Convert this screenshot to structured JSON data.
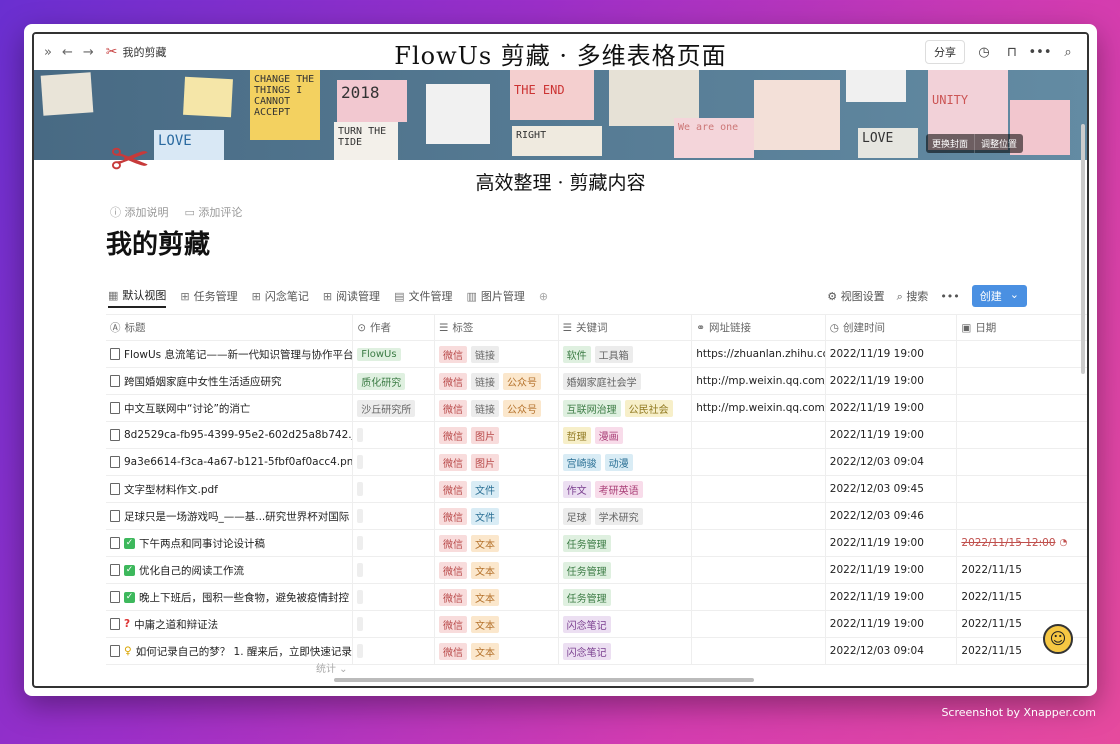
{
  "window": {
    "overlay_title": "FlowUs 剪藏 · 多维表格页面",
    "overlay_subtitle": "高效整理 · 剪藏内容",
    "breadcrumb": "我的剪藏",
    "share_label": "分享"
  },
  "cover": {
    "notes": [
      "CHANGE THE THINGS I CANNOT ACCEPT",
      "2018",
      "TURN THE TIDE",
      "THE END",
      "RIGHT",
      "LOVE",
      "UNITY",
      "We are one"
    ],
    "change_cover": "更换封面",
    "adjust_position": "调整位置"
  },
  "page": {
    "add_description": "添加说明",
    "add_comment": "添加评论",
    "title": "我的剪藏"
  },
  "views": {
    "tabs": [
      "默认视图",
      "任务管理",
      "闪念笔记",
      "阅读管理",
      "文件管理",
      "图片管理"
    ],
    "settings_label": "视图设置",
    "search_label": "搜索",
    "create_label": "创建"
  },
  "table": {
    "columns": [
      "标题",
      "作者",
      "标签",
      "关键词",
      "网址链接",
      "创建时间",
      "日期"
    ],
    "rows": [
      {
        "title": "FlowUs 息流笔记——新一代知识管理与协作平台",
        "author": "FlowUs",
        "tags": [
          "微信",
          "链接"
        ],
        "keywords": [
          "软件",
          "工具箱"
        ],
        "url": "https://zhuanlan.zhihu.com",
        "created": "2022/11/19 19:00",
        "date": ""
      },
      {
        "title": "跨国婚姻家庭中女性生活适应研究",
        "author": "质化研究",
        "tags": [
          "微信",
          "链接",
          "公众号"
        ],
        "keywords": [
          "婚姻家庭社会学"
        ],
        "url": "http://mp.weixin.qq.com/s?",
        "created": "2022/11/19 19:00",
        "date": ""
      },
      {
        "title": "中文互联网中“讨论”的消亡",
        "author": "沙丘研究所",
        "tags": [
          "微信",
          "链接",
          "公众号"
        ],
        "keywords": [
          "互联网治理",
          "公民社会"
        ],
        "url": "http://mp.weixin.qq.com/s?",
        "created": "2022/11/19 19:00",
        "date": ""
      },
      {
        "title": "8d2529ca-fb95-4399-95e2-602d25a8b742.jp",
        "author": "",
        "tags": [
          "微信",
          "图片"
        ],
        "keywords": [
          "哲理",
          "漫画"
        ],
        "url": "",
        "created": "2022/11/19 19:00",
        "date": ""
      },
      {
        "title": "9a3e6614-f3ca-4a67-b121-5fbf0af0acc4.png",
        "author": "",
        "tags": [
          "微信",
          "图片"
        ],
        "keywords": [
          "宫崎骏",
          "动漫"
        ],
        "url": "",
        "created": "2022/12/03 09:04",
        "date": ""
      },
      {
        "title": "文字型材料作文.pdf",
        "author": "",
        "tags": [
          "微信",
          "文件"
        ],
        "keywords": [
          "作文",
          "考研英语"
        ],
        "url": "",
        "created": "2022/12/03 09:45",
        "date": ""
      },
      {
        "title": "足球只是一场游戏吗_——基...研究世界杯对国际",
        "author": "",
        "tags": [
          "微信",
          "文件"
        ],
        "keywords": [
          "足球",
          "学术研究"
        ],
        "url": "",
        "created": "2022/12/03 09:46",
        "date": ""
      },
      {
        "title": "下午两点和同事讨论设计稿",
        "author": "",
        "tags": [
          "微信",
          "文本"
        ],
        "keywords": [
          "任务管理"
        ],
        "url": "",
        "created": "2022/11/19 19:00",
        "date": "2022/11/15 12:00"
      },
      {
        "title": "优化自己的阅读工作流",
        "author": "",
        "tags": [
          "微信",
          "文本"
        ],
        "keywords": [
          "任务管理"
        ],
        "url": "",
        "created": "2022/11/19 19:00",
        "date": "2022/11/15"
      },
      {
        "title": "晚上下班后，囤积一些食物，避免被疫情封控",
        "author": "",
        "tags": [
          "微信",
          "文本"
        ],
        "keywords": [
          "任务管理"
        ],
        "url": "",
        "created": "2022/11/19 19:00",
        "date": "2022/11/15"
      },
      {
        "title": "中庸之道和辩证法",
        "author": "",
        "tags": [
          "微信",
          "文本"
        ],
        "keywords": [
          "闪念笔记"
        ],
        "url": "",
        "created": "2022/11/19 19:00",
        "date": "2022/11/15"
      },
      {
        "title": "如何记录自己的梦？ 1. 醒来后，立即快速记录",
        "author": "",
        "tags": [
          "微信",
          "文本"
        ],
        "keywords": [
          "闪念笔记"
        ],
        "url": "",
        "created": "2022/12/03 09:04",
        "date": "2022/11/15"
      }
    ],
    "stat_label": "统计"
  },
  "credit": "Screenshot by Xnapper.com"
}
